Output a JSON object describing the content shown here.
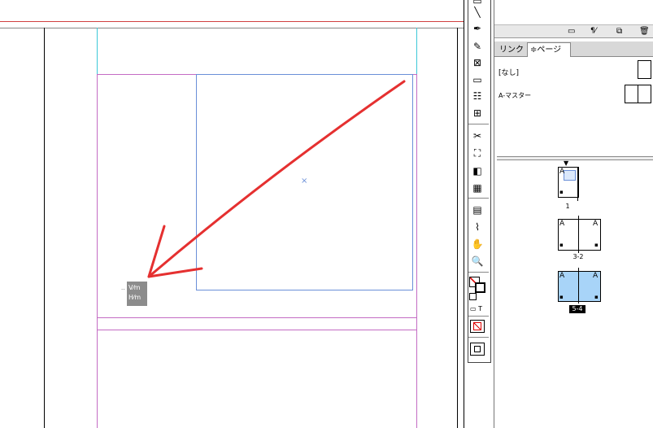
{
  "panel": {
    "tabs": [
      {
        "label": "リンク"
      },
      {
        "label": "≑ページ"
      }
    ],
    "masters": [
      {
        "label": "[なし]"
      },
      {
        "label": "A-マスター"
      }
    ],
    "pages": [
      {
        "label": "1",
        "marker": "A"
      },
      {
        "label": "3-2",
        "marker": "A"
      },
      {
        "label": "5-4",
        "marker": "A"
      }
    ]
  },
  "canvas": {
    "frame_text_lines": [
      "V⁄m",
      "H⁄m"
    ]
  },
  "colors": {
    "arrow": "#e53030",
    "margin_guide": "#c46cc4",
    "bleed_guide": "#3cc8d8",
    "selected_frame": "#6a8fd8",
    "selected_spread": "#a8d4f8",
    "ruler_guide": "#d04040"
  }
}
